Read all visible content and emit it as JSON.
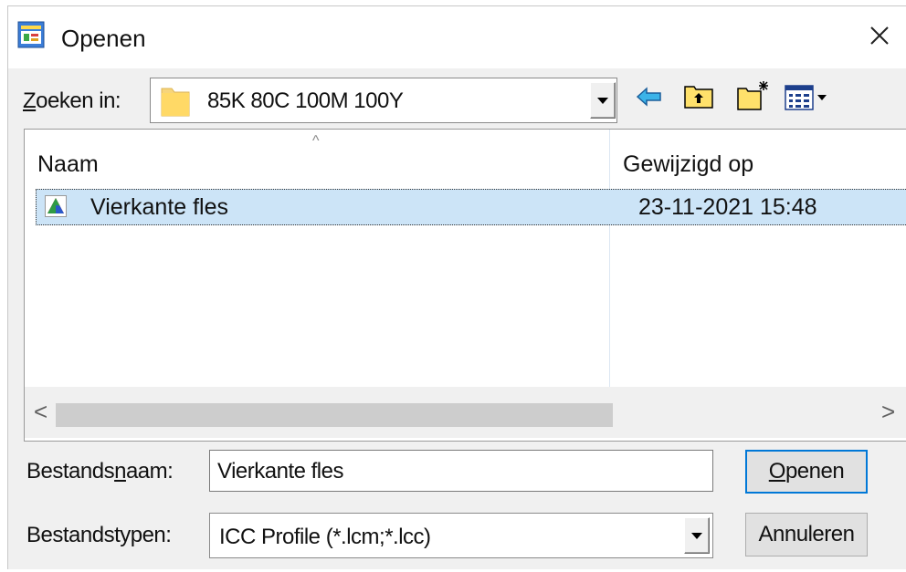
{
  "window": {
    "title": "Openen",
    "close_glyph": "✕",
    "icon": "app-window-icon"
  },
  "lookin": {
    "label_accel": "Z",
    "label_rest": "oeken in:",
    "value": "85K 80C 100M 100Y",
    "folder_icon": "folder-icon"
  },
  "toolbar": {
    "icons": [
      "back-arrow-icon",
      "up-folder-icon",
      "new-folder-icon",
      "view-menu-icon"
    ]
  },
  "file_list": {
    "columns": [
      "Naam",
      "Gewijzigd op"
    ],
    "rows": [
      {
        "name": "Vierkante fles",
        "modified": "23-11-2021 15:48",
        "icon": "icc-profile-icon",
        "selected": true
      }
    ],
    "sort_glyph": "^",
    "scroll_left_glyph": "<",
    "scroll_right_glyph": ">"
  },
  "filename": {
    "label_pre": "Bestands",
    "label_accel": "n",
    "label_post": "aam:",
    "value": "Vierkante fles"
  },
  "filetype": {
    "label": "Bestandstypen:",
    "value": "ICC Profile (*.lcm;*.lcc)"
  },
  "buttons": {
    "open_accel": "O",
    "open_rest": "penen",
    "cancel": "Annuleren"
  },
  "colors": {
    "selection": "#cce4f7",
    "accent": "#0078d7",
    "dialog_bg": "#f0f0f0"
  }
}
